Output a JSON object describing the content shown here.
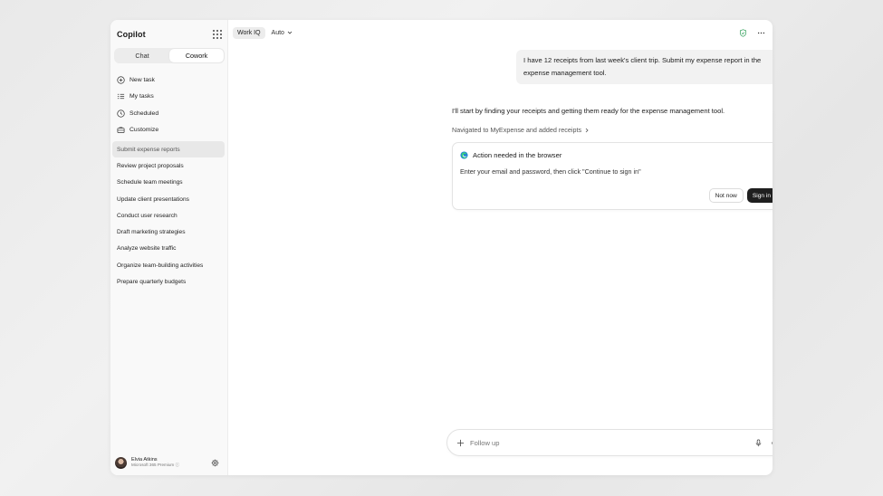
{
  "app": {
    "title": "Copilot"
  },
  "sidebar": {
    "modes": [
      {
        "label": "Chat"
      },
      {
        "label": "Cowork"
      }
    ],
    "nav": [
      {
        "label": "New task",
        "icon": "plus-circle-icon"
      },
      {
        "label": "My tasks",
        "icon": "list-icon"
      },
      {
        "label": "Scheduled",
        "icon": "clock-icon"
      },
      {
        "label": "Customize",
        "icon": "briefcase-icon"
      }
    ],
    "tasks": [
      {
        "label": "Submit expense reports"
      },
      {
        "label": "Review project proposals"
      },
      {
        "label": "Schedule team meetings"
      },
      {
        "label": "Update client presentations"
      },
      {
        "label": "Conduct user research"
      },
      {
        "label": "Draft marketing strategies"
      },
      {
        "label": "Analyze website traffic"
      },
      {
        "label": "Organize team-building activities"
      },
      {
        "label": "Prepare quarterly budgets"
      }
    ],
    "user": {
      "name": "Elvia Atkins",
      "plan": "Microsoft 365 Premium"
    }
  },
  "topbar": {
    "workiq": "Work IQ",
    "mode": "Auto"
  },
  "conversation": {
    "user_message": "I have 12 receipts from last week's client trip. Submit my expense report in the expense management tool.",
    "reply": "I'll start by finding your receipts and getting them ready for the expense management tool.",
    "status_link": "Navigated to MyExpense and added receipts"
  },
  "action_card": {
    "title": "Action needed in the browser",
    "body": "Enter your email and password, then click \"Continue to sign in\"",
    "secondary_label": "Not now",
    "primary_label": "Sign in"
  },
  "composer": {
    "placeholder": "Follow up"
  },
  "colors": {
    "accent": "#1f1f1f",
    "shield": "#2e9e58",
    "sidebar_bg": "#f9f9f9"
  }
}
